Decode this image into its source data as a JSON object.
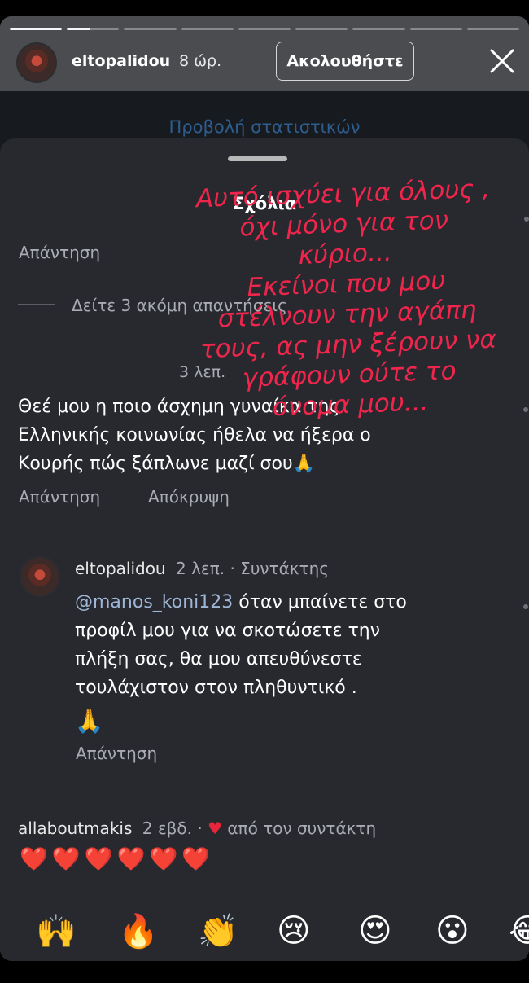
{
  "header": {
    "username": "eltopalidou",
    "time": "8 ώρ.",
    "follow_label": "Ακολουθήστε"
  },
  "stats_link": "Προβολή στατιστικών",
  "sheet": {
    "title": "Σχόλια"
  },
  "overlay_text": [
    "Αυτό ισχύει για όλους ,",
    "όχι μόνο για τον",
    "κύριο...",
    "Εκείνοι που μου",
    "στέλνουν την αγάπη",
    "τους, ας μην ξέρουν να",
    "γράφουν ούτε το",
    "όνομα μου..."
  ],
  "comments": {
    "top_reply": "Απάντηση",
    "view_more": "Δείτε 3 ακόμη απαντήσεις",
    "c1": {
      "time": "3 λεπ.",
      "lines": [
        "Θεέ μου η ποιο άσχημη γυναίκα της",
        "Ελληνικής κοινωνίας ήθελα να ήξερα ο",
        "Κουρής πώς ξάπλωνε μαζί σου🙏"
      ],
      "reply": "Απάντηση",
      "hide": "Απόκρυψη"
    },
    "c2": {
      "username": "eltopalidou",
      "meta": "2 λεπ. · Συντάκτης",
      "mention": "@manos_koni123",
      "line1": " όταν μπαίνετε στο",
      "line2": "προφίλ μου για να σκοτώσετε την",
      "line3": "πλήξη σας, θα μου απευθύνεστε",
      "line4": "τουλάχιστον στον πληθυντικό .",
      "emoji": "🙏",
      "reply": "Απάντηση"
    },
    "c3": {
      "username": "allaboutmakis",
      "meta": "2 εβδ. ·",
      "liked": "από τον συντάκτη",
      "hearts": "❤️❤️❤️❤️❤️❤️"
    }
  },
  "reactions": [
    "🙌",
    "🔥",
    "👏",
    "😢",
    "😍",
    "😮",
    "😂"
  ]
}
